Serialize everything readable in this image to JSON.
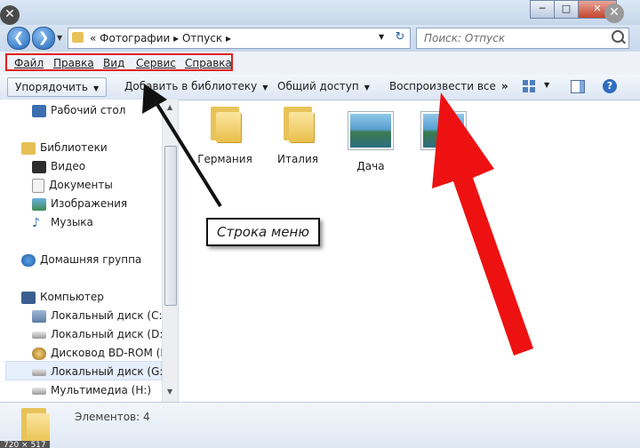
{
  "window": {
    "close_glyph": "✕",
    "min_glyph": "─",
    "max_glyph": "□",
    "winclose_glyph": "✕",
    "overlay_close_glyph": "✕"
  },
  "nav": {
    "back_glyph": "❮",
    "forward_glyph": "❯"
  },
  "address": {
    "crumbs": "« Фотографии ▸ Отпуск ▸",
    "refresh_glyph": "↻"
  },
  "search": {
    "placeholder": "Поиск: Отпуск"
  },
  "menu": {
    "items": [
      "Файл",
      "Правка",
      "Вид",
      "Сервис",
      "Справка"
    ]
  },
  "toolbar": {
    "sort": "Упорядочить",
    "library": "Добавить в библиотеку",
    "share": "Общий доступ",
    "play": "Воспроизвести все",
    "more": "»",
    "help": "?"
  },
  "navpane": {
    "items": [
      "Рабочий стол",
      "Библиотеки",
      "Видео",
      "Документы",
      "Изображения",
      "Музыка",
      "Домашняя группа",
      "Компьютер",
      "Локальный диск (C:)",
      "Локальный диск (D:)",
      "Дисковод BD-ROM (F:)",
      "Локальный диск (G:)",
      "Мультимедиа (H:)"
    ],
    "scroll_up": "▲",
    "scroll_down": "▼"
  },
  "files": [
    {
      "name": "Германия",
      "type": "folder"
    },
    {
      "name": "Италия",
      "type": "folder"
    },
    {
      "name": "Дача",
      "type": "photo"
    },
    {
      "name": "",
      "type": "photo"
    }
  ],
  "details": {
    "count": "Элементов: 4",
    "size_badge": "720 × 517"
  },
  "annotation": {
    "callout": "Строка меню",
    "highlight_color": "#e02020",
    "arrow_black": "#111111",
    "arrow_red": "#ee1111"
  }
}
